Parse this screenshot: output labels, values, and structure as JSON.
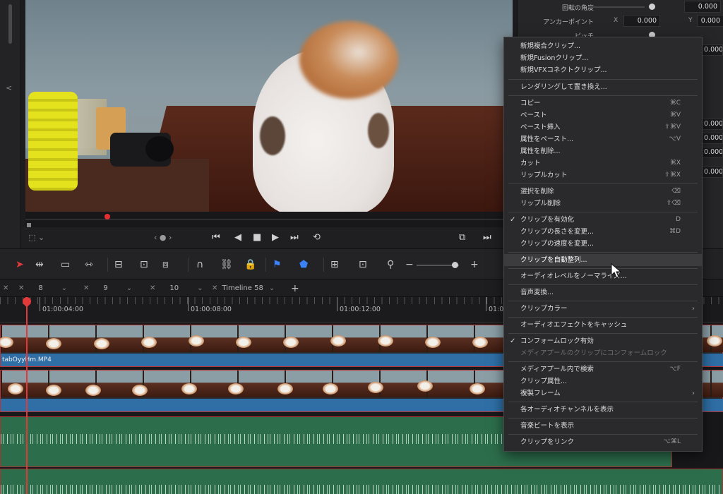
{
  "inspector": {
    "rotation_label": "回転の角度",
    "rotation_value": "0.000",
    "anchor_label": "アンカーポイント",
    "anchor_x_axis": "X",
    "anchor_x": "0.000",
    "anchor_y_axis": "Y",
    "anchor_y": "0.000",
    "pitch_label": "ピッチ",
    "side_values": [
      "0.000",
      "0.000",
      "0.000",
      "0.000",
      "0.000"
    ]
  },
  "timeline_tabs": [
    {
      "label": "8"
    },
    {
      "label": "9"
    },
    {
      "label": "10"
    },
    {
      "label": "Timeline 58"
    }
  ],
  "add_tab_label": "+",
  "ruler": {
    "timecodes": [
      "01:00:04:00",
      "01:00:08:00",
      "01:00:12:00",
      "01:00"
    ]
  },
  "tracks": {
    "video1_clip_name": "tabOyyHm.MP4"
  },
  "transport": {
    "jog": "‹ ● ›"
  },
  "context_menu": {
    "items": [
      {
        "label": "新規複合クリップ...",
        "shortcut": ""
      },
      {
        "label": "新規Fusionクリップ...",
        "shortcut": ""
      },
      {
        "label": "新規VFXコネクトクリップ...",
        "shortcut": ""
      },
      {
        "label": "レンダリングして置き換え...",
        "shortcut": ""
      },
      {
        "label": "コピー",
        "shortcut": "⌘C"
      },
      {
        "label": "ペースト",
        "shortcut": "⌘V"
      },
      {
        "label": "ペースト挿入",
        "shortcut": "⇧⌘V"
      },
      {
        "label": "属性をペースト...",
        "shortcut": "⌥V"
      },
      {
        "label": "属性を削除...",
        "shortcut": ""
      },
      {
        "label": "カット",
        "shortcut": "⌘X"
      },
      {
        "label": "リップルカット",
        "shortcut": "⇧⌘X"
      },
      {
        "label": "選択を削除",
        "shortcut": "⌫"
      },
      {
        "label": "リップル削除",
        "shortcut": "⇧⌫"
      },
      {
        "label": "クリップを有効化",
        "shortcut": "D",
        "checked": "✓"
      },
      {
        "label": "クリップの長さを変更...",
        "shortcut": "⌘D"
      },
      {
        "label": "クリップの速度を変更...",
        "shortcut": ""
      },
      {
        "label": "クリップを自動整列...",
        "shortcut": "",
        "highlighted": true
      },
      {
        "label": "オーディオレベルをノーマライズ...",
        "shortcut": ""
      },
      {
        "label": "音声変換...",
        "shortcut": ""
      },
      {
        "label": "クリップカラー",
        "shortcut": "",
        "submenu": "›"
      },
      {
        "label": "オーディオエフェクトをキャッシュ",
        "shortcut": ""
      },
      {
        "label": "コンフォームロック有効",
        "shortcut": "",
        "checked": "✓"
      },
      {
        "label": "メディアプールのクリップにコンフォームロック",
        "shortcut": "",
        "disabled": true
      },
      {
        "label": "メディアプール内で検索",
        "shortcut": "⌥F"
      },
      {
        "label": "クリップ属性...",
        "shortcut": ""
      },
      {
        "label": "複製フレーム",
        "shortcut": "",
        "submenu": "›"
      },
      {
        "label": "各オーディオチャンネルを表示",
        "shortcut": ""
      },
      {
        "label": "音楽ビートを表示",
        "shortcut": ""
      },
      {
        "label": "クリップをリンク",
        "shortcut": "⌥⌘L"
      }
    ]
  },
  "colors": {
    "accent_red": "#e23a3a",
    "video_clip_label": "#2f6fa6",
    "audio_clip": "#2c6e4c",
    "menu_bg": "#2a2a2c"
  }
}
